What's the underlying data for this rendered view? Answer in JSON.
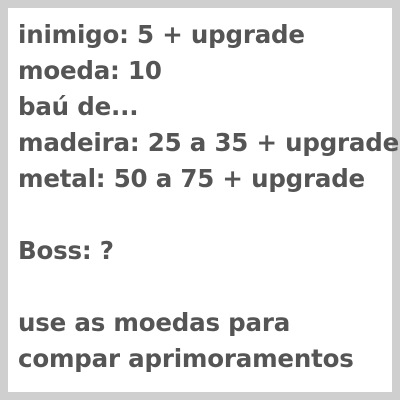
{
  "lines": {
    "enemy": "inimigo: 5 + upgrade",
    "coin": "moeda: 10",
    "chest": "baú de...",
    "wood": "madeira: 25 a 35 + upgrade",
    "metal": "metal: 50 a 75 + upgrade",
    "boss": "Boss: ?",
    "tip_line1": "use as moedas para",
    "tip_line2": "compar aprimoramentos"
  }
}
